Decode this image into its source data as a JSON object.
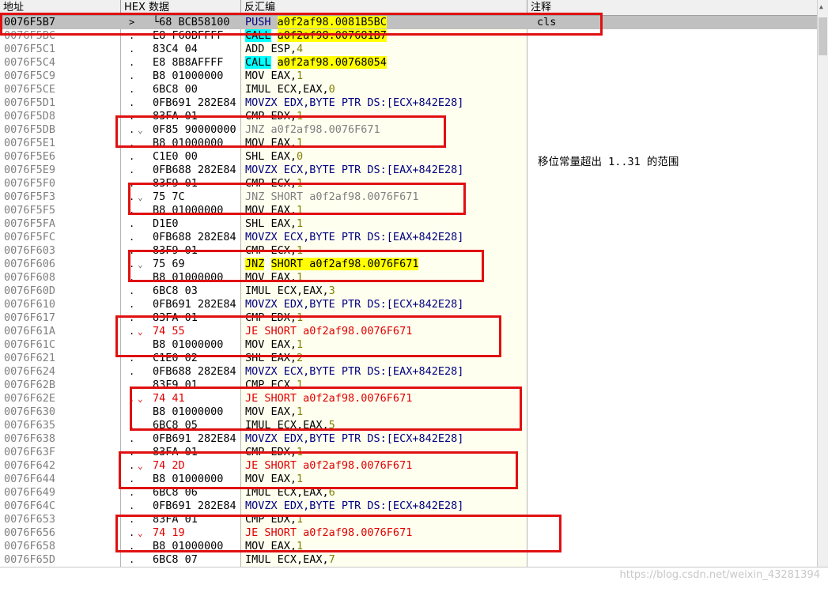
{
  "columns": {
    "address": "地址",
    "hex": "HEX 数据",
    "disasm": "反汇编",
    "comment": "注释"
  },
  "rows": [
    {
      "addr": "0076F5B7",
      "mark": ">",
      "jarrow": "",
      "hex": "└68 BCB58100",
      "asm": [
        {
          "t": "PUSH",
          "c": "op"
        },
        {
          "t": " "
        },
        {
          "t": "a0f2af98.0081B5BC",
          "c": "hl-y"
        }
      ],
      "comment": "cls",
      "selected": true
    },
    {
      "addr": "0076F5BC",
      "mark": ".",
      "jarrow": "",
      "hex": "E8 F68BFFFF",
      "asm": [
        {
          "t": "CALL",
          "c": "hl-c"
        },
        {
          "t": " "
        },
        {
          "t": "a0f2af98.007681B7",
          "c": "hl-y"
        }
      ]
    },
    {
      "addr": "0076F5C1",
      "mark": ".",
      "jarrow": "",
      "hex": "83C4 04",
      "asm": [
        {
          "t": "ADD ESP,"
        },
        {
          "t": "4",
          "c": "num"
        }
      ]
    },
    {
      "addr": "0076F5C4",
      "mark": ".",
      "jarrow": "",
      "hex": "E8 8B8AFFFF",
      "asm": [
        {
          "t": "CALL",
          "c": "hl-c"
        },
        {
          "t": " "
        },
        {
          "t": "a0f2af98.00768054",
          "c": "hl-y"
        }
      ]
    },
    {
      "addr": "0076F5C9",
      "mark": ".",
      "jarrow": "",
      "hex": "B8 01000000",
      "asm": [
        {
          "t": "MOV EAX,"
        },
        {
          "t": "1",
          "c": "num"
        }
      ]
    },
    {
      "addr": "0076F5CE",
      "mark": ".",
      "jarrow": "",
      "hex": "6BC8 00",
      "asm": [
        {
          "t": "IMUL ECX,EAX,"
        },
        {
          "t": "0",
          "c": "num"
        }
      ]
    },
    {
      "addr": "0076F5D1",
      "mark": ".",
      "jarrow": "",
      "hex": "0FB691 282E84",
      "asm": [
        {
          "t": "MOVZX EDX,",
          "c": "op"
        },
        {
          "t": "BYTE PTR DS:[ECX+842E28]",
          "c": "op"
        }
      ]
    },
    {
      "addr": "0076F5D8",
      "mark": ".",
      "jarrow": "",
      "hex": "83FA 01",
      "asm": [
        {
          "t": "CMP EDX,"
        },
        {
          "t": "1",
          "c": "num"
        }
      ]
    },
    {
      "addr": "0076F5DB",
      "mark": ".",
      "jarrow": "⌄",
      "hex": "0F85 90000000",
      "asm": [
        {
          "t": "JNZ a0f2af98.0076F671",
          "c": "gray"
        }
      ]
    },
    {
      "addr": "0076F5E1",
      "mark": ".",
      "jarrow": "",
      "hex": "B8 01000000",
      "asm": [
        {
          "t": "MOV EAX,"
        },
        {
          "t": "1",
          "c": "num"
        }
      ]
    },
    {
      "addr": "0076F5E6",
      "mark": ".",
      "jarrow": "",
      "hex": "C1E0 00",
      "asm": [
        {
          "t": "SHL EAX,"
        },
        {
          "t": "0",
          "c": "num"
        }
      ]
    },
    {
      "addr": "0076F5E9",
      "mark": ".",
      "jarrow": "",
      "hex": "0FB688 282E84",
      "asm": [
        {
          "t": "MOVZX ECX,BYTE PTR DS:[EAX+842E28]",
          "c": "op"
        }
      ]
    },
    {
      "addr": "0076F5F0",
      "mark": ".",
      "jarrow": "",
      "hex": "83F9 01",
      "asm": [
        {
          "t": "CMP ECX,"
        },
        {
          "t": "1",
          "c": "num"
        }
      ]
    },
    {
      "addr": "0076F5F3",
      "mark": ".",
      "jarrow": "⌄",
      "hex": "75 7C",
      "asm": [
        {
          "t": "JNZ SHORT a0f2af98.0076F671",
          "c": "gray"
        }
      ]
    },
    {
      "addr": "0076F5F5",
      "mark": ".",
      "jarrow": "",
      "hex": "B8 01000000",
      "asm": [
        {
          "t": "MOV EAX,"
        },
        {
          "t": "1",
          "c": "num"
        }
      ]
    },
    {
      "addr": "0076F5FA",
      "mark": ".",
      "jarrow": "",
      "hex": "D1E0",
      "asm": [
        {
          "t": "SHL EAX,"
        },
        {
          "t": "1",
          "c": "num"
        }
      ]
    },
    {
      "addr": "0076F5FC",
      "mark": ".",
      "jarrow": "",
      "hex": "0FB688 282E84",
      "asm": [
        {
          "t": "MOVZX ECX,BYTE PTR DS:[EAX+842E28]",
          "c": "op"
        }
      ]
    },
    {
      "addr": "0076F603",
      "mark": ".",
      "jarrow": "",
      "hex": "83F9 01",
      "asm": [
        {
          "t": "CMP ECX,"
        },
        {
          "t": "1",
          "c": "num"
        }
      ]
    },
    {
      "addr": "0076F606",
      "mark": ".",
      "jarrow": "⌄",
      "hex": "75 69",
      "asm": [
        {
          "t": "JNZ",
          "c": "hl-y"
        },
        {
          "t": " "
        },
        {
          "t": "SHORT a0f2af98.0076F671",
          "c": "hl-y"
        }
      ]
    },
    {
      "addr": "0076F608",
      "mark": ".",
      "jarrow": "",
      "hex": "B8 01000000",
      "asm": [
        {
          "t": "MOV EAX,"
        },
        {
          "t": "1",
          "c": "num"
        }
      ]
    },
    {
      "addr": "0076F60D",
      "mark": ".",
      "jarrow": "",
      "hex": "6BC8 03",
      "asm": [
        {
          "t": "IMUL ECX,EAX,"
        },
        {
          "t": "3",
          "c": "num"
        }
      ]
    },
    {
      "addr": "0076F610",
      "mark": ".",
      "jarrow": "",
      "hex": "0FB691 282E84",
      "asm": [
        {
          "t": "MOVZX EDX,BYTE PTR DS:[ECX+842E28]",
          "c": "op"
        }
      ]
    },
    {
      "addr": "0076F617",
      "mark": ".",
      "jarrow": "",
      "hex": "83FA 01",
      "asm": [
        {
          "t": "CMP EDX,"
        },
        {
          "t": "1",
          "c": "num"
        }
      ]
    },
    {
      "addr": "0076F61A",
      "mark": ".",
      "jarrow": "⌄",
      "hex": "74 55",
      "hexred": true,
      "asm": [
        {
          "t": "JE SHORT a0f2af98.0076F671",
          "c": "red"
        }
      ]
    },
    {
      "addr": "0076F61C",
      "mark": "",
      "jarrow": "",
      "hex": "B8 01000000",
      "asm": [
        {
          "t": "MOV EAX,"
        },
        {
          "t": "1",
          "c": "num"
        }
      ]
    },
    {
      "addr": "0076F621",
      "mark": ".",
      "jarrow": "",
      "hex": "C1E0 02",
      "asm": [
        {
          "t": "SHL EAX,"
        },
        {
          "t": "2",
          "c": "num"
        }
      ]
    },
    {
      "addr": "0076F624",
      "mark": ".",
      "jarrow": "",
      "hex": "0FB688 282E84",
      "asm": [
        {
          "t": "MOVZX ECX,BYTE PTR DS:[EAX+842E28]",
          "c": "op"
        }
      ]
    },
    {
      "addr": "0076F62B",
      "mark": ".",
      "jarrow": "",
      "hex": "83F9 01",
      "asm": [
        {
          "t": "CMP ECX,"
        },
        {
          "t": "1",
          "c": "num"
        }
      ]
    },
    {
      "addr": "0076F62E",
      "mark": ".",
      "jarrow": "⌄",
      "hex": "74 41",
      "hexred": true,
      "asm": [
        {
          "t": "JE SHORT a0f2af98.0076F671",
          "c": "red"
        }
      ]
    },
    {
      "addr": "0076F630",
      "mark": "",
      "jarrow": "",
      "hex": "B8 01000000",
      "asm": [
        {
          "t": "MOV EAX,"
        },
        {
          "t": "1",
          "c": "num"
        }
      ]
    },
    {
      "addr": "0076F635",
      "mark": ".",
      "jarrow": "",
      "hex": "6BC8 05",
      "asm": [
        {
          "t": "IMUL ECX,EAX,"
        },
        {
          "t": "5",
          "c": "num"
        }
      ]
    },
    {
      "addr": "0076F638",
      "mark": ".",
      "jarrow": "",
      "hex": "0FB691 282E84",
      "asm": [
        {
          "t": "MOVZX EDX,BYTE PTR DS:[ECX+842E28]",
          "c": "op"
        }
      ]
    },
    {
      "addr": "0076F63F",
      "mark": ".",
      "jarrow": "",
      "hex": "83FA 01",
      "asm": [
        {
          "t": "CMP EDX,"
        },
        {
          "t": "1",
          "c": "num"
        }
      ]
    },
    {
      "addr": "0076F642",
      "mark": ".",
      "jarrow": "⌄",
      "hex": "74 2D",
      "hexred": true,
      "asm": [
        {
          "t": "JE SHORT a0f2af98.0076F671",
          "c": "red"
        }
      ]
    },
    {
      "addr": "0076F644",
      "mark": ".",
      "jarrow": "",
      "hex": "B8 01000000",
      "asm": [
        {
          "t": "MOV EAX,"
        },
        {
          "t": "1",
          "c": "num"
        }
      ]
    },
    {
      "addr": "0076F649",
      "mark": ".",
      "jarrow": "",
      "hex": "6BC8 06",
      "asm": [
        {
          "t": "IMUL ECX,EAX,"
        },
        {
          "t": "6",
          "c": "num"
        }
      ]
    },
    {
      "addr": "0076F64C",
      "mark": ".",
      "jarrow": "",
      "hex": "0FB691 282E84",
      "asm": [
        {
          "t": "MOVZX EDX,BYTE PTR DS:[ECX+842E28]",
          "c": "op"
        }
      ]
    },
    {
      "addr": "0076F653",
      "mark": ".",
      "jarrow": "",
      "hex": "83FA 01",
      "asm": [
        {
          "t": "CMP EDX,"
        },
        {
          "t": "1",
          "c": "num"
        }
      ]
    },
    {
      "addr": "0076F656",
      "mark": ".",
      "jarrow": "⌄",
      "hex": "74 19",
      "hexred": true,
      "asm": [
        {
          "t": "JE SHORT a0f2af98.0076F671",
          "c": "red"
        }
      ]
    },
    {
      "addr": "0076F658",
      "mark": ".",
      "jarrow": "",
      "hex": "B8 01000000",
      "asm": [
        {
          "t": "MOV EAX,"
        },
        {
          "t": "1",
          "c": "num"
        }
      ]
    },
    {
      "addr": "0076F65D",
      "mark": ".",
      "jarrow": "",
      "hex": "6BC8 07",
      "asm": [
        {
          "t": "IMUL ECX,EAX,"
        },
        {
          "t": "7",
          "c": "num"
        }
      ]
    }
  ],
  "side_comment": "移位常量超出 1..31 的范围",
  "watermark": "https://blog.csdn.net/weixin_43281394",
  "colors": {
    "highlight_yellow": "#ffff00",
    "highlight_cyan": "#00ffff",
    "jump_red": "#e00000",
    "annotation_red": "#e01010",
    "selection_gray": "#c0c0c0"
  }
}
